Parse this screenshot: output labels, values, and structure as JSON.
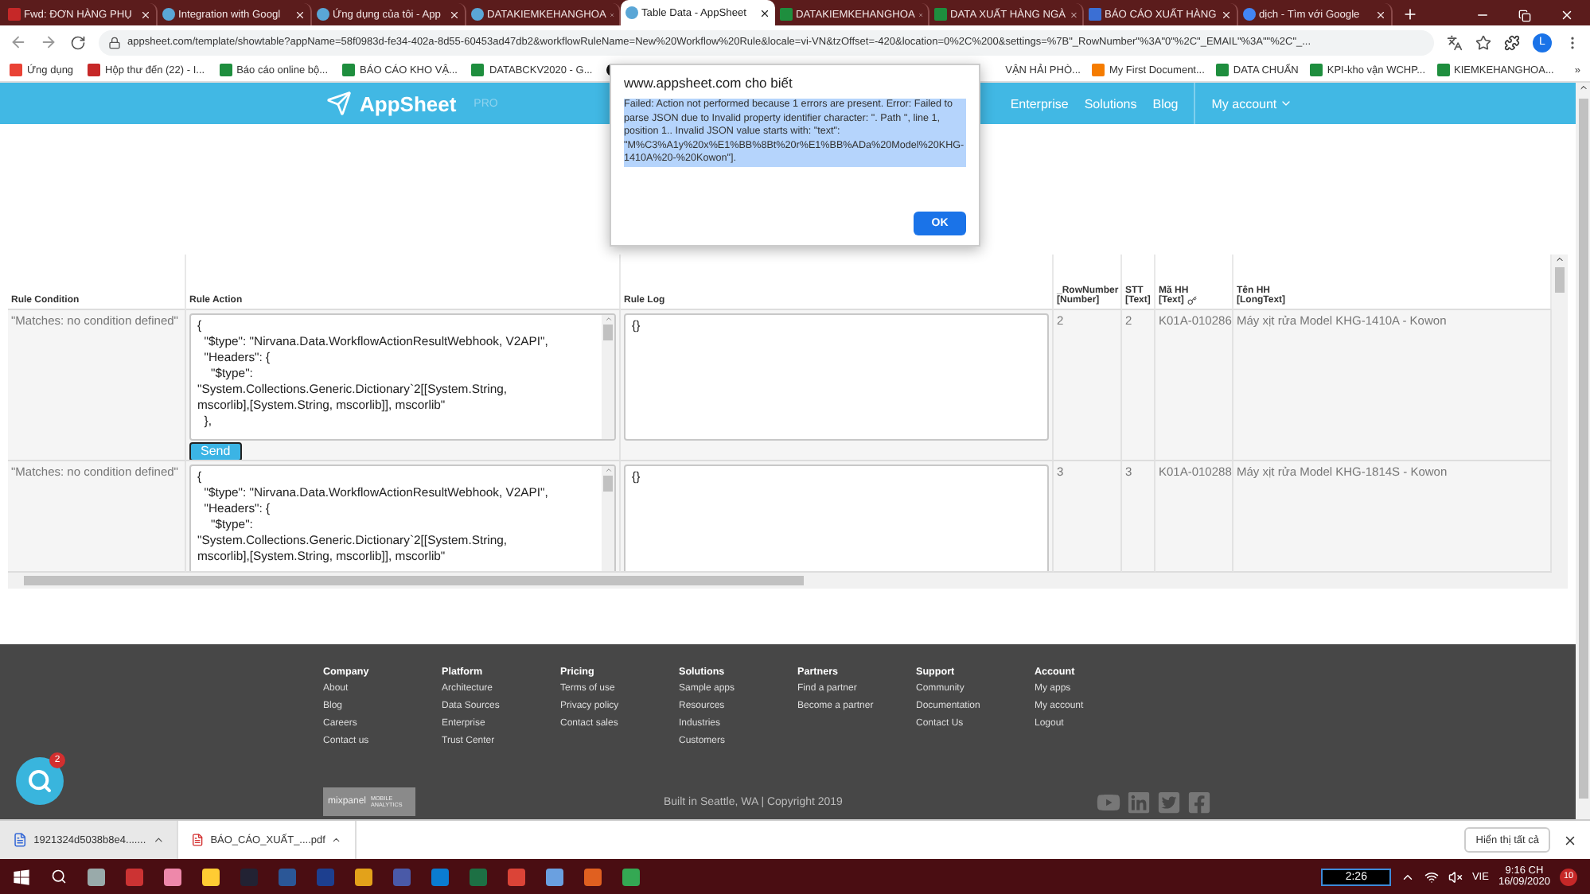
{
  "browser": {
    "tabs": [
      {
        "title": "Fwd: ĐƠN HÀNG PHỤ",
        "selected": false
      },
      {
        "title": "Integration with Googl",
        "selected": false
      },
      {
        "title": "Ứng dụng của tôi - App",
        "selected": false
      },
      {
        "title": "DATAKIEMKEHANGHOA",
        "selected": false
      },
      {
        "title": "Table Data - AppSheet",
        "selected": true
      },
      {
        "title": "DATAKIEMKEHANGHOA",
        "selected": false
      },
      {
        "title": "DATA XUẤT HÀNG NGÀ",
        "selected": false
      },
      {
        "title": "BÁO CÁO XUẤT HÀNG",
        "selected": false
      },
      {
        "title": "dịch - Tìm với Google",
        "selected": false
      }
    ],
    "address": "appsheet.com/template/showtable?appName=58f0983d-fe34-402a-8d55-60453ad47db2&workflowRuleName=New%20Workflow%20Rule&locale=vi-VN&tzOffset=-420&location=0%2C%200&settings=%7B\"_RowNumber\"%3A\"0\"%2C\"_EMAIL\"%3A\"\"%2C\"_...",
    "avatar": "L",
    "bookmarks_left": [
      "Ứng dụng",
      "Hộp thư đến (22) - I...",
      "Báo cáo online bộ...",
      "BÁO CÁO KHO VẬ...",
      "DATABCKV2020 - G..."
    ],
    "bookmarks_right": [
      "VẬN HẢI PHÒ...",
      "My First Document...",
      "DATA CHUẨN",
      "KPI-kho vận WCHP...",
      "KIEMKEHANGHOA..."
    ],
    "more": "»"
  },
  "header": {
    "logo": "AppSheet",
    "badge": "PRO",
    "nav": [
      "Enterprise",
      "Solutions",
      "Blog"
    ],
    "account": "My account"
  },
  "dialog": {
    "title": "www.appsheet.com cho biết",
    "message": "Failed: Action not performed because 1 errors are present. Error: Failed to parse JSON due to Invalid property identifier character: \". Path '', line 1, position 1.. Invalid JSON value starts with: \"text\": \"M%C3%A1y%20x%E1%BB%8Bt%20r%E1%BB%ADa%20Model%20KHG-1410A%20-%20Kowon\"].",
    "button": "OK"
  },
  "table": {
    "columns": [
      {
        "name": "Rule Condition"
      },
      {
        "name": "Rule Action"
      },
      {
        "name": "Rule Log"
      },
      {
        "name": "_RowNumber",
        "type": "[Number]",
        "key": false
      },
      {
        "name": "STT",
        "type": "[Text]",
        "key": false
      },
      {
        "name": "Mã HH",
        "type": "[Text]",
        "key": true
      },
      {
        "name": "Tên HH",
        "type": "[LongText]",
        "key": false
      }
    ],
    "rows": [
      {
        "condition": "\"Matches: no condition defined\"",
        "action": "{\n  \"$type\": \"Nirvana.Data.WorkflowActionResultWebhook, V2API\",\n  \"Headers\": {\n    \"$type\":\n\"System.Collections.Generic.Dictionary`2[[System.String,\nmscorlib],[System.String, mscorlib]], mscorlib\"\n  },",
        "send": "Send",
        "log": "{}",
        "row_number": "2",
        "stt": "2",
        "code": "K01A-010286",
        "name": "Máy xịt rửa Model KHG-1410A - Kowon"
      },
      {
        "condition": "\"Matches: no condition defined\"",
        "action": "{\n  \"$type\": \"Nirvana.Data.WorkflowActionResultWebhook, V2API\",\n  \"Headers\": {\n    \"$type\":\n\"System.Collections.Generic.Dictionary`2[[System.String,\nmscorlib],[System.String, mscorlib]], mscorlib\"",
        "log": "{}",
        "row_number": "3",
        "stt": "3",
        "code": "K01A-010288",
        "name": "Máy xịt rửa Model KHG-1814S - Kowon"
      }
    ]
  },
  "footer": {
    "columns": [
      {
        "heading": "Company",
        "links": [
          "About",
          "Blog",
          "Careers",
          "Contact us"
        ]
      },
      {
        "heading": "Platform",
        "links": [
          "Architecture",
          "Data Sources",
          "Enterprise",
          "Trust Center"
        ]
      },
      {
        "heading": "Pricing",
        "links": [
          "Terms of use",
          "Privacy policy",
          "Contact sales"
        ]
      },
      {
        "heading": "Solutions",
        "links": [
          "Sample apps",
          "Resources",
          "Industries",
          "Customers"
        ]
      },
      {
        "heading": "Partners",
        "links": [
          "Find a partner",
          "Become a partner"
        ]
      },
      {
        "heading": "Support",
        "links": [
          "Community",
          "Documentation",
          "Contact Us"
        ]
      },
      {
        "heading": "Account",
        "links": [
          "My apps",
          "My account",
          "Logout"
        ]
      }
    ],
    "mixpanel": {
      "brand": "mixpanel",
      "tag": "MOBILE\nANALYTICS"
    },
    "copyright": "Built in Seattle, WA | Copyright 2019",
    "chat_badge": "2"
  },
  "downloads": {
    "items": [
      "1921324d5038b8e4.......",
      "BÁO_CÁO_XUẤT_....pdf"
    ],
    "show_all": "Hiển thị tất cả"
  },
  "taskbar": {
    "battery": "2:26",
    "language": "VIE",
    "time": "9:16 CH",
    "date": "16/09/2020",
    "notifications": "10"
  }
}
